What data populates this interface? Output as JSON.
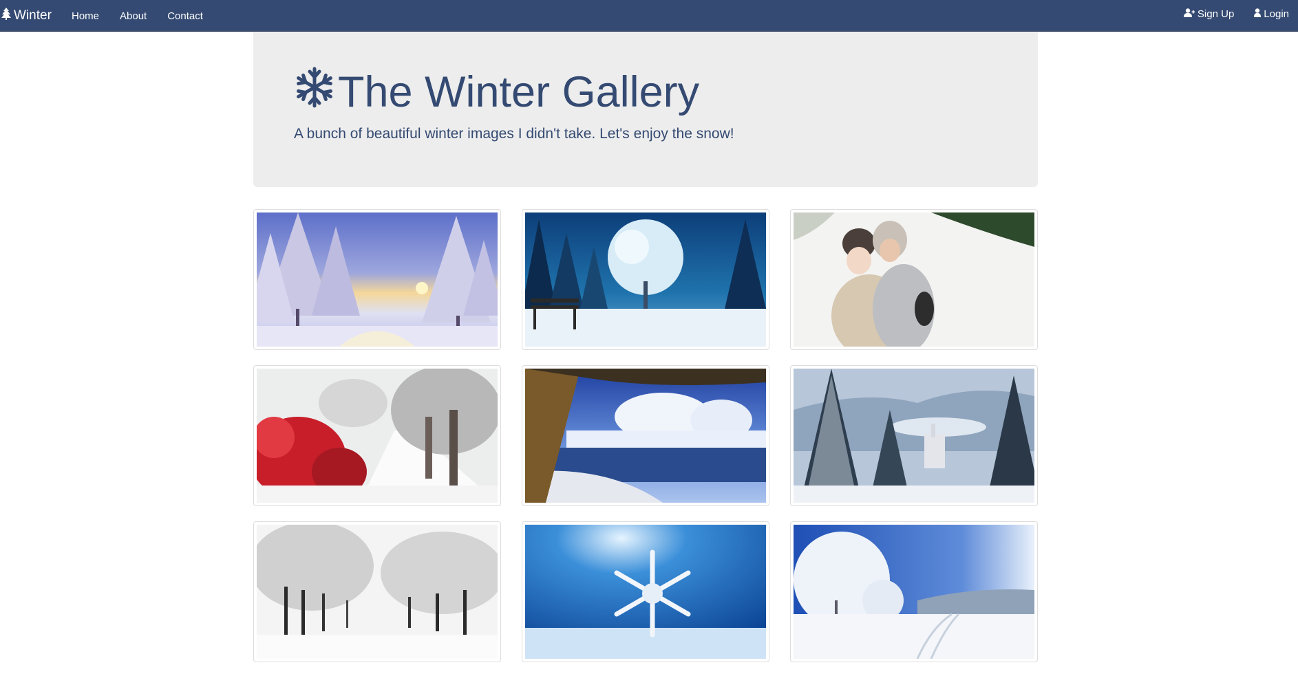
{
  "navbar": {
    "brand": "Winter",
    "links": [
      "Home",
      "About",
      "Contact"
    ],
    "signup": "Sign Up",
    "login": "Login",
    "brand_icon": "tree-icon",
    "signup_icon": "user-plus-icon",
    "login_icon": "user-icon"
  },
  "jumbotron": {
    "title": "The Winter Gallery",
    "title_icon": "snowflake-icon",
    "subtitle": "A bunch of beautiful winter images I didn't take. Let's enjoy the snow!"
  },
  "gallery": {
    "images": [
      "snowy-pine-forest-sunset",
      "frosted-tree-with-bench",
      "couple-hugging-in-snow",
      "red-berries-snowy-path",
      "frozen-river-with-trees",
      "snowy-pines-and-castle",
      "white-tree-lined-lane",
      "snowflake-closeup",
      "snowy-trail-blue-sky"
    ]
  },
  "colors": {
    "navbar": "#344a72",
    "accent_text": "#344a72",
    "jumbotron_bg": "#ededed"
  }
}
